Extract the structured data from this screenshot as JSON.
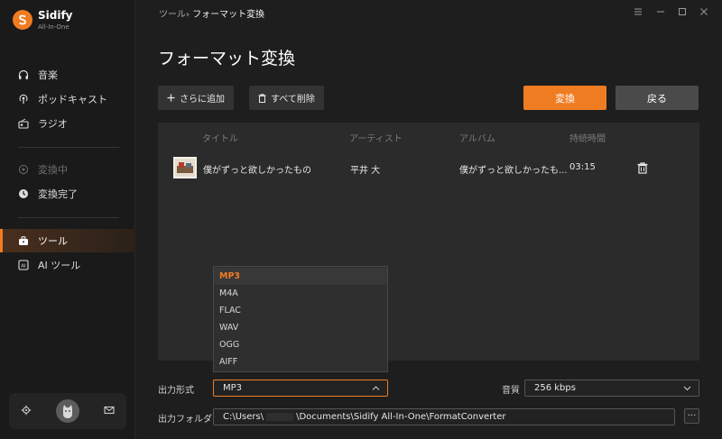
{
  "brand": {
    "name": "Sidify",
    "subtitle": "All-In-One"
  },
  "sidebar": {
    "items": [
      {
        "label": "音楽",
        "icon": "headphones-icon"
      },
      {
        "label": "ポッドキャスト",
        "icon": "podcast-icon"
      },
      {
        "label": "ラジオ",
        "icon": "radio-icon"
      },
      {
        "label": "変換中",
        "icon": "converting-icon"
      },
      {
        "label": "変換完了",
        "icon": "clock-icon"
      },
      {
        "label": "ツール",
        "icon": "toolbox-icon"
      },
      {
        "label": "AI ツール",
        "icon": "ai-icon"
      }
    ]
  },
  "breadcrumb": {
    "parent": "ツール",
    "separator": "›",
    "current": "フォーマット変換"
  },
  "page_title": "フォーマット変換",
  "toolbar": {
    "add_label": "さらに追加",
    "delete_all_label": "すべて削除",
    "convert_label": "変換",
    "back_label": "戻る"
  },
  "table": {
    "headers": [
      "タイトル",
      "アーティスト",
      "アルバム",
      "持続時間"
    ],
    "rows": [
      {
        "title": "僕がずっと欲しかったもの",
        "artist": "平井 大",
        "album": "僕がずっと欲しかったも...",
        "duration": "03:15"
      }
    ]
  },
  "format_options": [
    "MP3",
    "M4A",
    "FLAC",
    "WAV",
    "OGG",
    "AIFF"
  ],
  "settings": {
    "output_format_label": "出力形式",
    "output_format_value": "MP3",
    "quality_label": "音質",
    "quality_value": "256 kbps",
    "output_folder_label": "出力フォルダ",
    "path_prefix": "C:\\Users\\",
    "path_suffix": "\\Documents\\Sidify All-In-One\\FormatConverter",
    "more_label": "···"
  },
  "colors": {
    "accent": "#f07c22",
    "background": "#1e1e1e",
    "panel": "#2b2b2b"
  }
}
